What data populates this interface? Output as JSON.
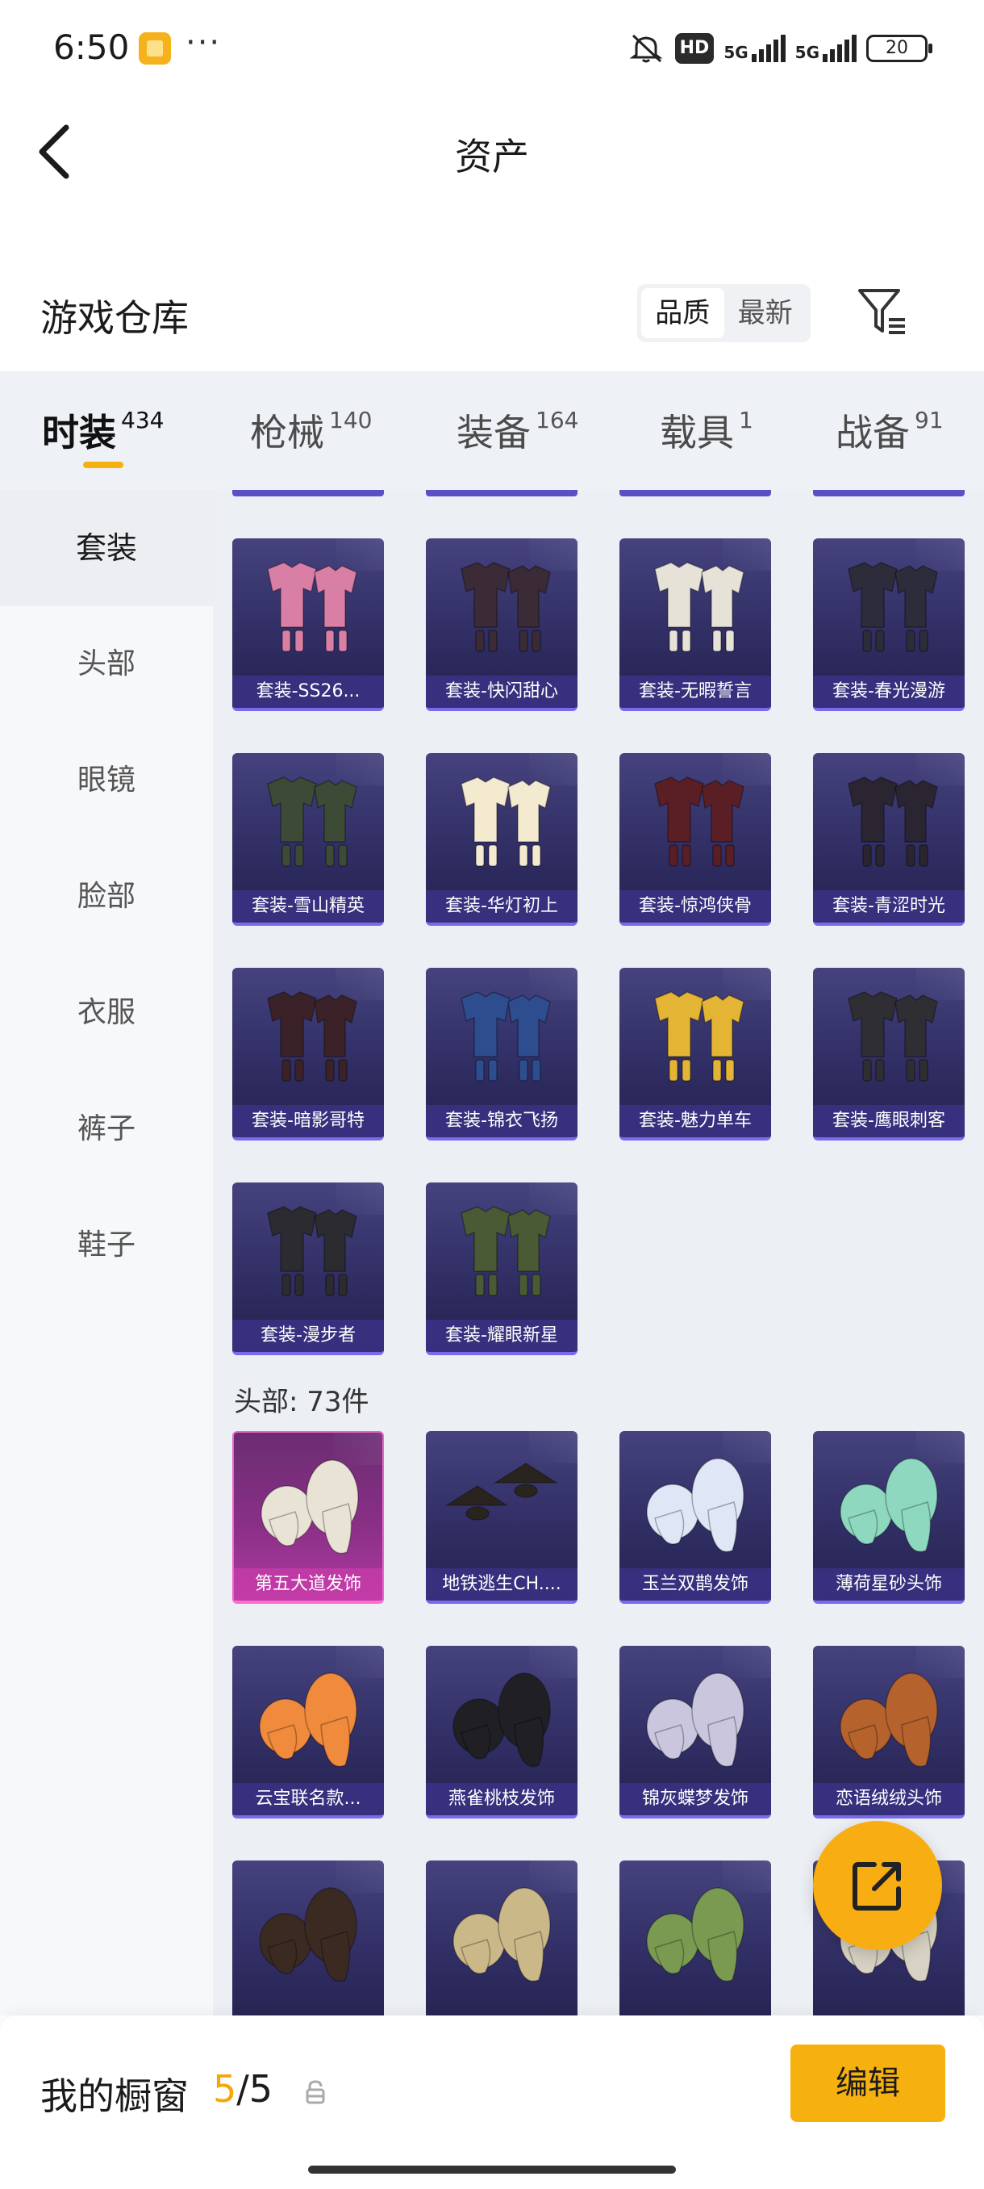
{
  "status_bar": {
    "time": "6:50",
    "more": "···",
    "hd": "HD",
    "net1": "5G",
    "net2": "5G",
    "battery": "20"
  },
  "nav": {
    "title": "资产"
  },
  "warehouse": {
    "title": "游戏仓库",
    "sort_options": [
      "品质",
      "最新"
    ],
    "active_sort": 0
  },
  "tabs": [
    {
      "label": "时装",
      "count": "434"
    },
    {
      "label": "枪械",
      "count": "140"
    },
    {
      "label": "装备",
      "count": "164"
    },
    {
      "label": "载具",
      "count": "1"
    },
    {
      "label": "战备",
      "count": "91"
    }
  ],
  "active_tab": 0,
  "sidebar": {
    "items": [
      {
        "label": "套装"
      },
      {
        "label": "头部"
      },
      {
        "label": "眼镜"
      },
      {
        "label": "脸部"
      },
      {
        "label": "衣服"
      },
      {
        "label": "裤子"
      },
      {
        "label": "鞋子"
      }
    ],
    "active": 0
  },
  "sets": [
    {
      "label": "套装-SS26...",
      "kind": "outfit",
      "color": "#d97fa6"
    },
    {
      "label": "套装-快闪甜心",
      "kind": "outfit",
      "color": "#3a2b36"
    },
    {
      "label": "套装-无暇誓言",
      "kind": "outfit",
      "color": "#e6e2d8"
    },
    {
      "label": "套装-春光漫游",
      "kind": "outfit",
      "color": "#2c2c3a"
    },
    {
      "label": "套装-雪山精英",
      "kind": "outfit",
      "color": "#3d4a35"
    },
    {
      "label": "套装-华灯初上",
      "kind": "outfit",
      "color": "#f3ead0"
    },
    {
      "label": "套装-惊鸿侠骨",
      "kind": "outfit",
      "color": "#5a1f24"
    },
    {
      "label": "套装-青涩时光",
      "kind": "outfit",
      "color": "#2a2530"
    },
    {
      "label": "套装-暗影哥特",
      "kind": "outfit",
      "color": "#3b2228"
    },
    {
      "label": "套装-锦衣飞扬",
      "kind": "outfit",
      "color": "#2e4d8f"
    },
    {
      "label": "套装-魅力单车",
      "kind": "outfit",
      "color": "#e4b534"
    },
    {
      "label": "套装-鹰眼刺客",
      "kind": "outfit",
      "color": "#2e2e33"
    },
    {
      "label": "套装-漫步者",
      "kind": "outfit",
      "color": "#2b2b30"
    },
    {
      "label": "套装-耀眼新星",
      "kind": "outfit",
      "color": "#4a5a35"
    }
  ],
  "head_section": {
    "label": "头部: 73件"
  },
  "head_items": [
    {
      "label": "第五大道发饰",
      "kind": "hair",
      "color": "#e9e3d6",
      "highlight": true
    },
    {
      "label": "地铁逃生CH....",
      "kind": "hat",
      "color": "#2a241e"
    },
    {
      "label": "玉兰双鹊发饰",
      "kind": "hair",
      "color": "#dfe6f5"
    },
    {
      "label": "薄荷星砂头饰",
      "kind": "hair",
      "color": "#8ed8c0"
    },
    {
      "label": "云宝联名款...",
      "kind": "hair",
      "color": "#f08a3c"
    },
    {
      "label": "燕雀桃枝发饰",
      "kind": "hair",
      "color": "#1f1f24"
    },
    {
      "label": "锦灰蝶梦发饰",
      "kind": "hair",
      "color": "#c9c6de"
    },
    {
      "label": "恋语绒绒头饰",
      "kind": "hair",
      "color": "#b5622c"
    },
    {
      "label": "",
      "kind": "hair",
      "color": "#3a2a22"
    },
    {
      "label": "",
      "kind": "hair",
      "color": "#cbb889"
    },
    {
      "label": "",
      "kind": "hair",
      "color": "#7a9a52"
    },
    {
      "label": "",
      "kind": "hair",
      "color": "#d8d2c4"
    }
  ],
  "bottom_bar": {
    "label": "我的橱窗",
    "shown": "5",
    "total": "/5",
    "edit": "编辑"
  },
  "icons": {
    "back": "back-arrow-icon",
    "filter": "filter-icon",
    "share": "share-out-icon",
    "lock": "lock-icon"
  },
  "accent": "#f5b10f"
}
